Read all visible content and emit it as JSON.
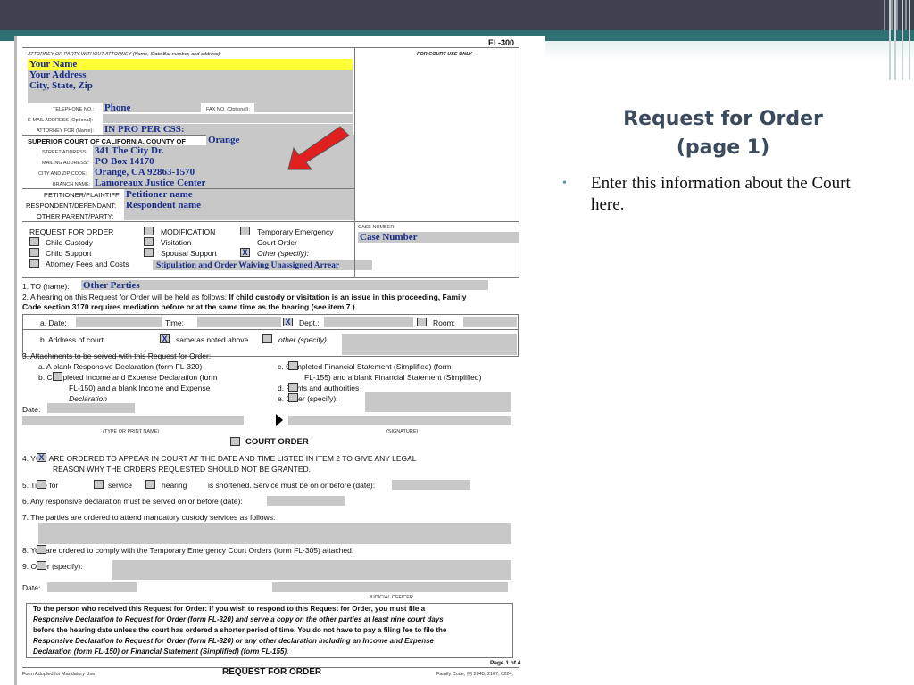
{
  "slide": {
    "title_line1": "Request for Order",
    "title_line2": "(page 1)",
    "bullet_text": "Enter this information about the Court here."
  },
  "form": {
    "form_id": "FL-300",
    "court_use": "FOR COURT USE ONLY",
    "attorney_header": "ATTORNEY OR PARTY WITHOUT ATTORNEY (Name, State Bar number, and address):",
    "your_name": "Your Name",
    "your_address": "Your Address",
    "city_state_zip": "City, State, Zip",
    "telephone_label": "TELEPHONE NO.:",
    "phone": "Phone",
    "fax_label": "FAX NO. (Optional):",
    "email_label": "E-MAIL ADDRESS (Optional):",
    "attorney_for_label": "ATTORNEY FOR (Name):",
    "attorney_for_value": "IN PRO PER    CSS:",
    "superior_court_label": "SUPERIOR COURT OF CALIFORNIA, COUNTY OF",
    "county": "Orange",
    "street_label": "STREET ADDRESS:",
    "street": "341 The City Dr.",
    "mailing_label": "MAILING ADDRESS:",
    "mailing": "PO Box 14170",
    "cityzip_label": "CITY AND ZIP CODE:",
    "cityzip": "Orange, CA  92863-1570",
    "branch_label": "BRANCH NAME:",
    "branch": "Lamoreaux Justice Center",
    "petitioner_label": "PETITIONER/PLAINTIFF:",
    "petitioner": "Petitioner name",
    "respondent_label": "RESPONDENT/DEFENDANT:",
    "respondent": "Respondent name",
    "other_parent_label": "OTHER PARENT/PARTY:",
    "rfo_label": "REQUEST FOR ORDER",
    "child_custody": "Child Custody",
    "child_support": "Child Support",
    "attorney_fees": "Attorney Fees and Costs",
    "modification": "MODIFICATION",
    "visitation": "Visitation",
    "spousal_support": "Spousal Support",
    "temp_emergency_1": "Temporary Emergency",
    "temp_emergency_2": "Court Order",
    "other_specify": "Other (specify):",
    "other_value": "Stipulation and Order Waiving Unassigned Arrear",
    "case_number_label": "CASE NUMBER:",
    "case_number": "Case Number",
    "item1": "1.   TO (name):",
    "item1_value": "Other Parties",
    "item2a": "2.   A hearing on this Request for Order will be held as follows:",
    "item2b": "If child custody or visitation is an issue in this proceeding, Family",
    "item2c": "Code section 3170 requires mediation before or at the same time as the hearing (see item 7.)",
    "date_label": "a.  Date:",
    "time_label": "Time:",
    "dept_label": "Dept.:",
    "room_label": "Room:",
    "address_label": "b.  Address of court",
    "same_as_above": "same as noted above",
    "other_specify2": "other (specify):",
    "item3": "3.   Attachments to be served with this Request for Order:",
    "item3a": "a.   A blank Responsive Declaration (form FL-320)",
    "item3b1": "b.        Completed Income and Expense Declaration (form",
    "item3b2": "FL-150) and a blank Income and Expense",
    "item3b3": "Declaration",
    "item3c1": "c.        Completed Financial Statement (Simplified) (form",
    "item3c2": "FL-155) and a blank Financial Statement (Simplified)",
    "item3d": "d.        Points and authorities",
    "item3e": "e.        Other (specify):",
    "date_short": "Date:",
    "type_or_print": "(TYPE OR PRINT NAME)",
    "signature": "(SIGNATURE)",
    "court_order": "COURT ORDER",
    "item4a": "4.       YOU ARE ORDERED TO APPEAR IN COURT AT THE DATE AND TIME LISTED IN ITEM 2 TO GIVE ANY LEGAL",
    "item4b": "REASON WHY THE ORDERS REQUESTED SHOULD NOT BE GRANTED.",
    "item5a": "5.       Time for",
    "item5b": "service",
    "item5c": "hearing",
    "item5d": "is shortened. Service must be on or before (date):",
    "item6": "6.   Any responsive declaration must be served on or before (date):",
    "item7": "7.   The parties are ordered to attend mandatory custody services as follows:",
    "item8": "8.       You are ordered to comply with the Temporary Emergency Court Orders (form FL-305) attached.",
    "item9": "9.       Other (specify):",
    "judicial_officer": "JUDICIAL OFFICER",
    "notice1": "To the person who received this Request for Order: If you wish to respond to this Request for Order, you must file a",
    "notice2": "Responsive Declaration to Request for Order (form FL-320) and serve a copy on the other parties at least nine court days",
    "notice3": "before the hearing date unless the court has ordered a shorter period of time. You do not have to pay a filing fee to file the",
    "notice4": "Responsive Declaration to Request for Order (form FL-320) or any other declaration including an Income and Expense",
    "notice5": "Declaration (form FL-150) or Financial Statement (Simplified) (form FL-155).",
    "page_of": "Page 1 of 4",
    "footer_left": "Form Adopted for Mandatory Use",
    "footer_title": "REQUEST FOR ORDER",
    "footer_right": "Family Code, §§ 2045, 2107, 6224,"
  },
  "colors": {
    "topbar": "#3d4150",
    "accent_teal": "#2e6f73",
    "title": "#3b4a5c",
    "bullet_dot": "#5a8fa0",
    "field_value": "#1a2e8a",
    "highlight": "#ffff33",
    "field_fill": "#c8c8c8",
    "arrow": "#e02020"
  }
}
